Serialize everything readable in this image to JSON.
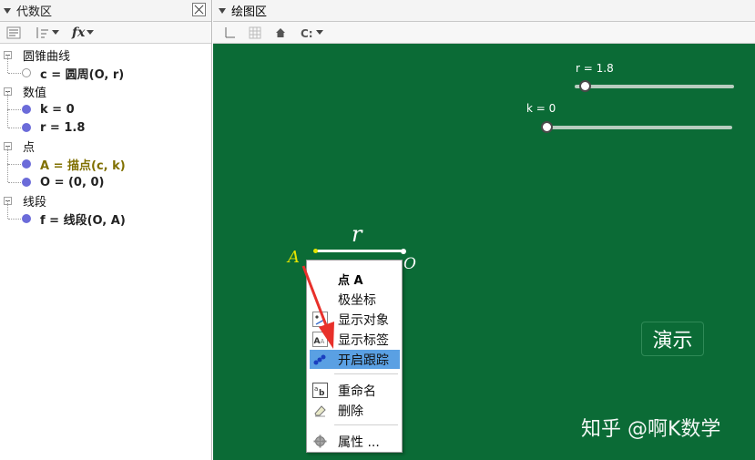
{
  "algebra_panel": {
    "title": "代数区",
    "toolbar": {
      "fx_label": "fx"
    },
    "categories": [
      {
        "label": "圆锥曲线",
        "items": [
          {
            "label": "c = 圆周(O, r)",
            "style": "hollow"
          }
        ]
      },
      {
        "label": "数值",
        "items": [
          {
            "label": "k = 0",
            "style": "filled"
          },
          {
            "label": "r = 1.8",
            "style": "filled"
          }
        ]
      },
      {
        "label": "点",
        "items": [
          {
            "label": "A = 描点(c, k)",
            "style": "filled-olive"
          },
          {
            "label": "O = (0, 0)",
            "style": "filled"
          }
        ]
      },
      {
        "label": "线段",
        "items": [
          {
            "label": "f = 线段(O, A)",
            "style": "filled"
          }
        ]
      }
    ]
  },
  "graphics_panel": {
    "title": "绘图区",
    "background_color": "#0b6b36",
    "sliders": {
      "r": {
        "label": "r = 1.8",
        "value": 1.8
      },
      "k": {
        "label": "k = 0",
        "value": 0
      }
    },
    "labels": {
      "r": "r",
      "A": "A",
      "O": "O"
    },
    "demo_button": "演示",
    "watermark": "知乎 @啊K数学"
  },
  "context_menu": {
    "header": "点 A",
    "items": [
      {
        "label": "极坐标",
        "icon": "none"
      },
      {
        "label": "显示对象",
        "icon": "show-object-icon"
      },
      {
        "label": "显示标签",
        "icon": "show-label-icon"
      },
      {
        "label": "开启跟踪",
        "icon": "trace-icon",
        "highlighted": true
      },
      {
        "label": "重命名",
        "icon": "rename-icon"
      },
      {
        "label": "删除",
        "icon": "eraser-icon"
      },
      {
        "label": "属性 ...",
        "icon": "gear-icon"
      }
    ]
  },
  "colors": {
    "accent_highlight": "#5aa0e3",
    "point_dot": "#6b6bd9",
    "point_A": "#e3e300",
    "arrow": "#e8302a"
  }
}
